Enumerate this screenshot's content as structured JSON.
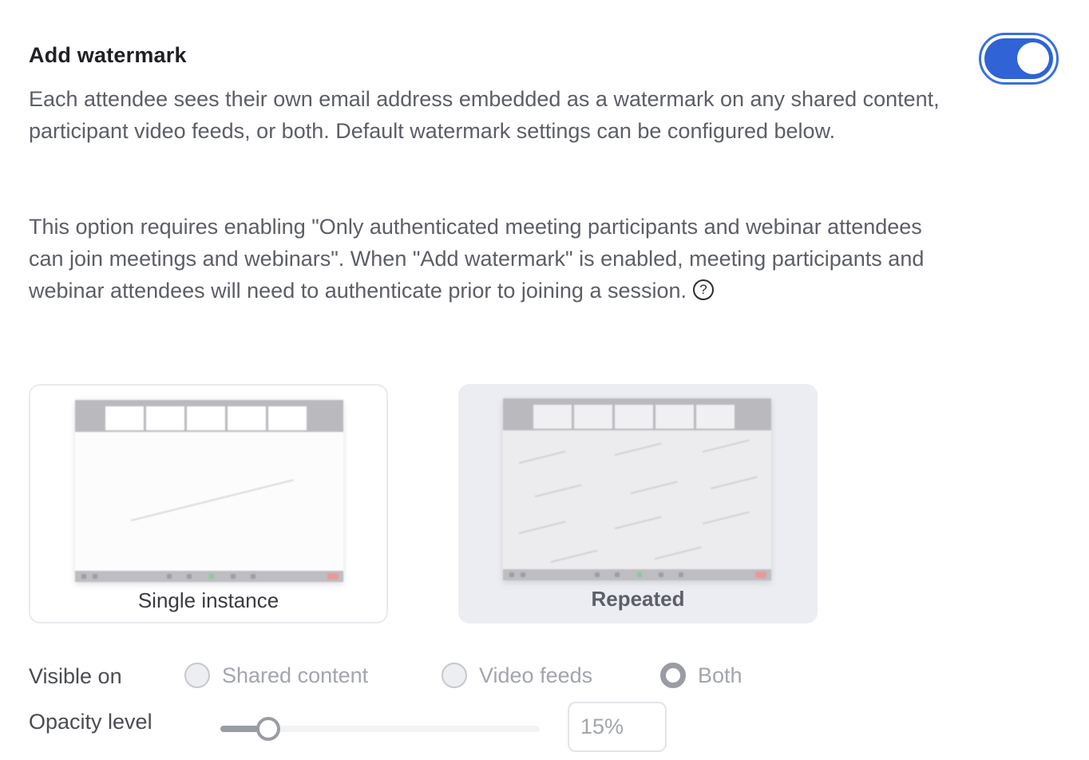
{
  "setting": {
    "title": "Add watermark",
    "enabled": true,
    "description_1": "Each attendee sees their own email address embedded as a watermark on any shared content, participant video feeds, or both. Default watermark settings can be configured below.",
    "description_2": "This option requires enabling \"Only authenticated meeting participants and webinar attendees can join meetings and webinars\". When \"Add watermark\" is enabled, meeting participants and webinar attendees will need to authenticate prior to joining a session.",
    "help_icon": "question-circle-icon"
  },
  "watermark_styles": {
    "selected": "Repeated",
    "options": [
      {
        "label": "Single instance"
      },
      {
        "label": "Repeated"
      }
    ]
  },
  "visible_on": {
    "label": "Visible on",
    "selected": "Both",
    "options": [
      "Shared content",
      "Video feeds",
      "Both"
    ]
  },
  "opacity": {
    "label": "Opacity level",
    "value_percent": 15,
    "input_value": "15%"
  },
  "colors": {
    "toggle_on": "#2f63d6",
    "disabled_text": "#a3a5ac",
    "selected_card_bg": "#ecedf2"
  }
}
